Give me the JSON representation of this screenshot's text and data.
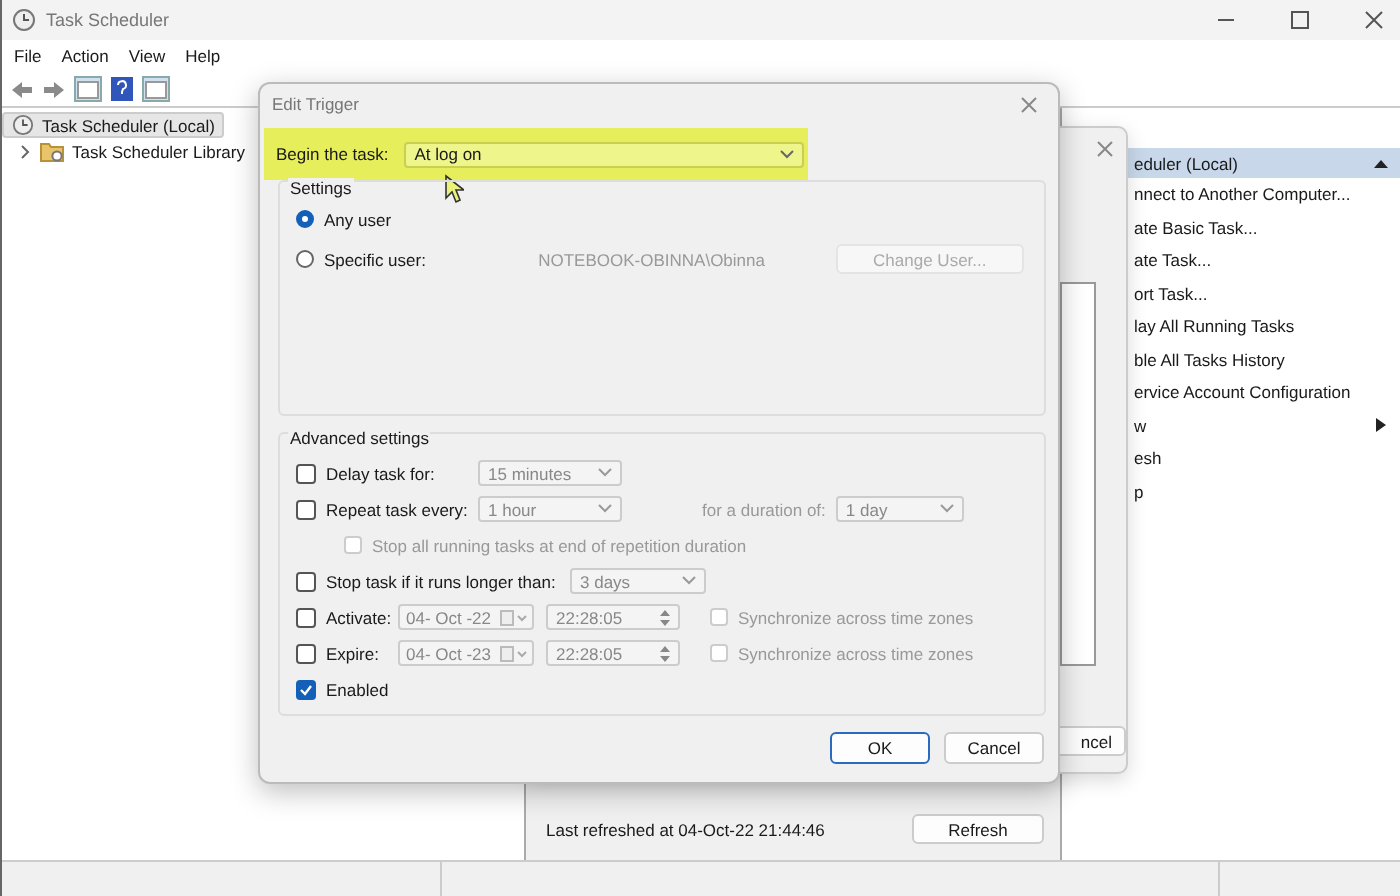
{
  "window": {
    "title": "Task Scheduler"
  },
  "menu": [
    "File",
    "Action",
    "View",
    "Help"
  ],
  "tree": [
    {
      "label": "Task Scheduler (Local)",
      "selected": true,
      "children": [
        {
          "label": "Task Scheduler Library",
          "selected": false,
          "expanded": false
        }
      ]
    }
  ],
  "actions": {
    "header": "eduler (Local)",
    "items": [
      {
        "label": "nnect to Another Computer...",
        "submenu": false
      },
      {
        "label": "ate Basic Task...",
        "submenu": false
      },
      {
        "label": "ate Task...",
        "submenu": false
      },
      {
        "label": "ort Task...",
        "submenu": false
      },
      {
        "label": "lay All Running Tasks",
        "submenu": false
      },
      {
        "label": "ble All Tasks History",
        "submenu": false
      },
      {
        "label": "ervice Account Configuration",
        "submenu": false
      },
      {
        "label": "w",
        "submenu": true
      },
      {
        "label": "esh",
        "submenu": false
      },
      {
        "label": "p",
        "submenu": false
      }
    ]
  },
  "summary": {
    "last_refreshed": "Last refreshed at 04-Oct-22 21:44:46",
    "refresh_button": "Refresh"
  },
  "back_dialog": {
    "cancel_button": "ncel"
  },
  "edit_trigger": {
    "title": "Edit Trigger",
    "begin_label": "Begin the task:",
    "begin_value": "At log on",
    "settings_title": "Settings",
    "users": [
      {
        "label": "Any user",
        "selected": true
      },
      {
        "label": "Specific user:",
        "selected": false
      }
    ],
    "specific_account": "NOTEBOOK-OBINNA\\Obinna",
    "change_user_button": "Change User...",
    "advanced_title": "Advanced settings",
    "delay": {
      "label": "Delay task for:",
      "checked": false,
      "value": "15 minutes"
    },
    "repeat": {
      "label": "Repeat task every:",
      "checked": false,
      "value": "1 hour",
      "duration_label": "for a duration of:",
      "duration_value": "1 day"
    },
    "stop_all": {
      "label": "Stop all running tasks at end of repetition duration",
      "checked": false
    },
    "stop_longer": {
      "label": "Stop task if it runs longer than:",
      "checked": false,
      "value": "3 days"
    },
    "schedule": [
      {
        "label": "Activate:",
        "checked": false,
        "date": "04- Oct -22",
        "time": "22:28:05",
        "sync_label": "Synchronize across time zones",
        "sync_checked": false
      },
      {
        "label": "Expire:",
        "checked": false,
        "date": "04- Oct -23",
        "time": "22:28:05",
        "sync_label": "Synchronize across time zones",
        "sync_checked": false
      }
    ],
    "enabled": {
      "label": "Enabled",
      "checked": true
    },
    "buttons": [
      {
        "label": "OK",
        "default": true
      },
      {
        "label": "Cancel",
        "default": false
      }
    ]
  }
}
